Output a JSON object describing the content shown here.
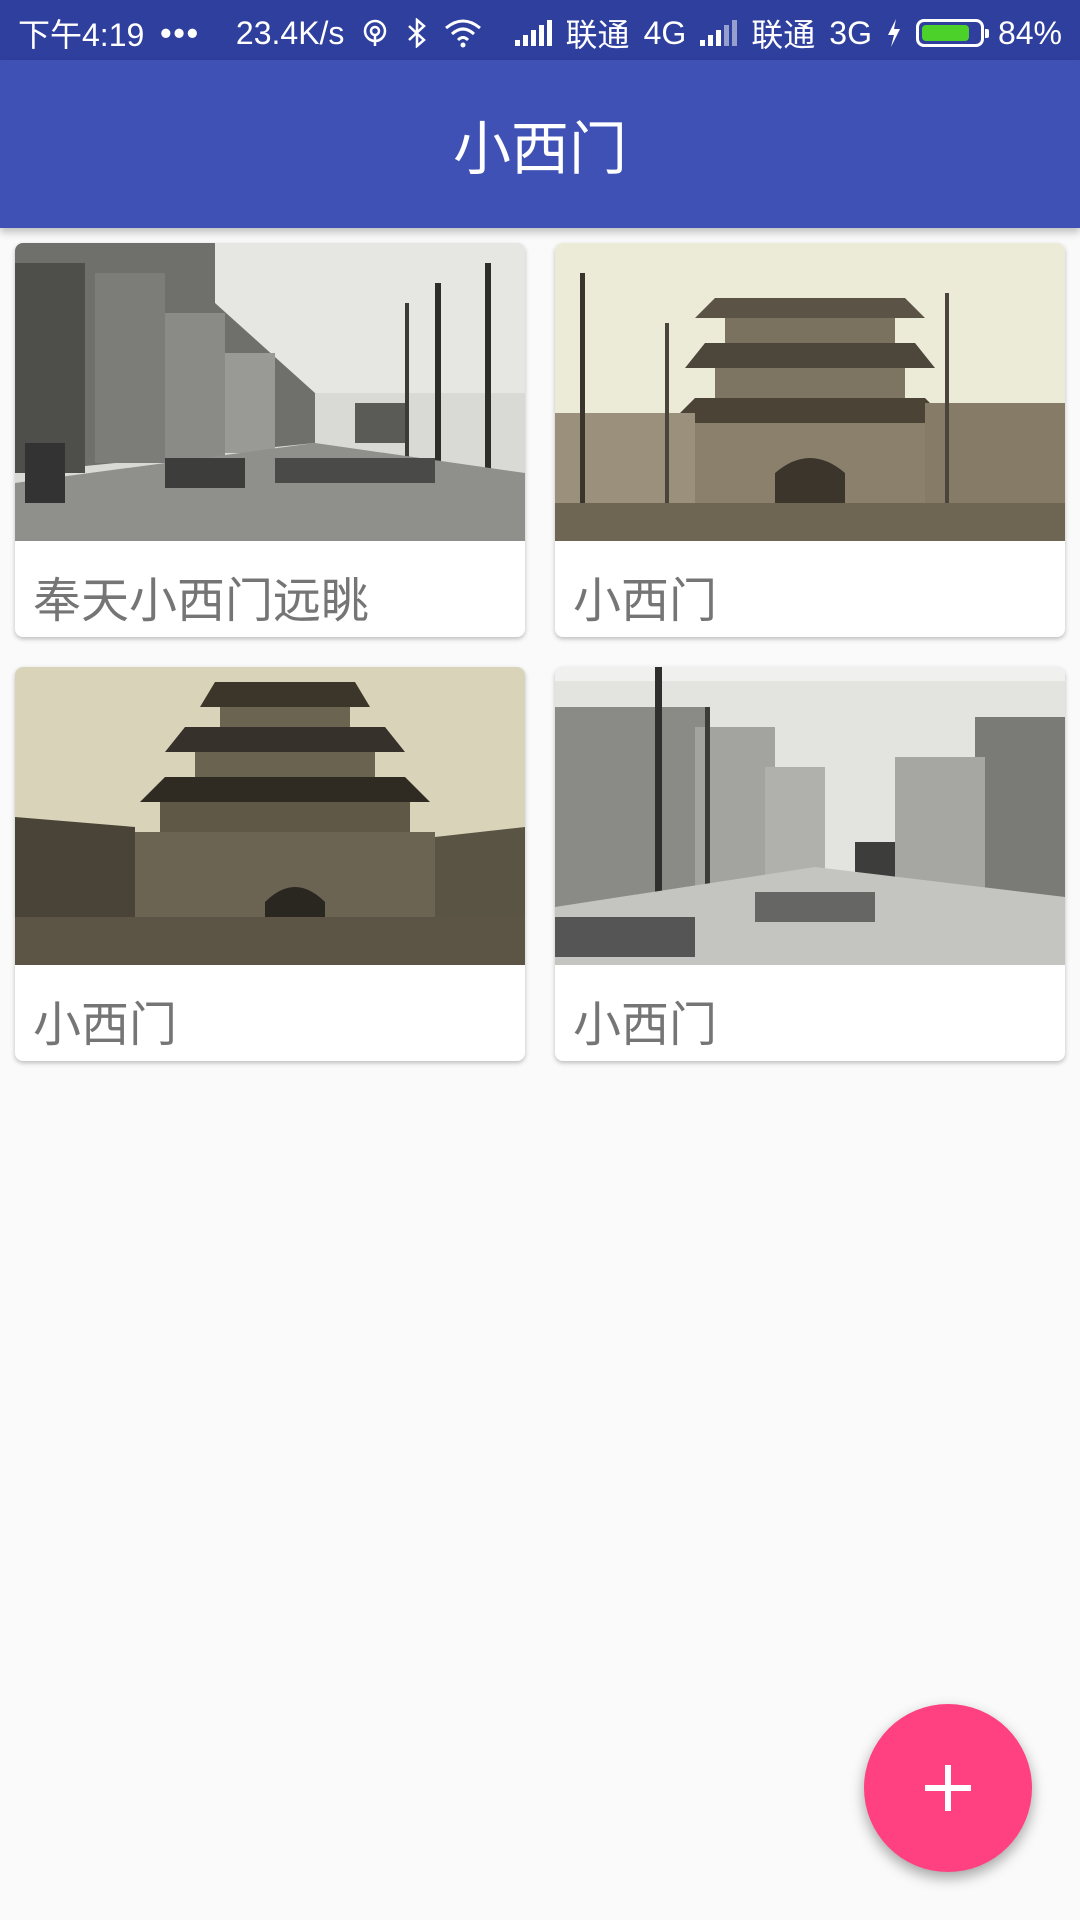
{
  "status_bar": {
    "time": "下午4:19",
    "dots": "•••",
    "net_speed": "23.4K/s",
    "carrier1": "联通",
    "net1": "4G",
    "carrier2": "联通",
    "net2": "3G",
    "battery_text": "84%",
    "battery_level": 0.84,
    "battery_color": "#4cd12a"
  },
  "app_bar": {
    "title": "小西门",
    "color": "#3f51b5"
  },
  "cards": [
    {
      "label": "奉天小西门远眺",
      "image": "street-scene-photo"
    },
    {
      "label": "小西门",
      "image": "gate-tower-photo"
    },
    {
      "label": "小西门",
      "image": "gate-tower-photo"
    },
    {
      "label": "小西门",
      "image": "tram-street-photo"
    }
  ],
  "fab": {
    "icon": "plus-icon",
    "color": "#ff4081"
  }
}
